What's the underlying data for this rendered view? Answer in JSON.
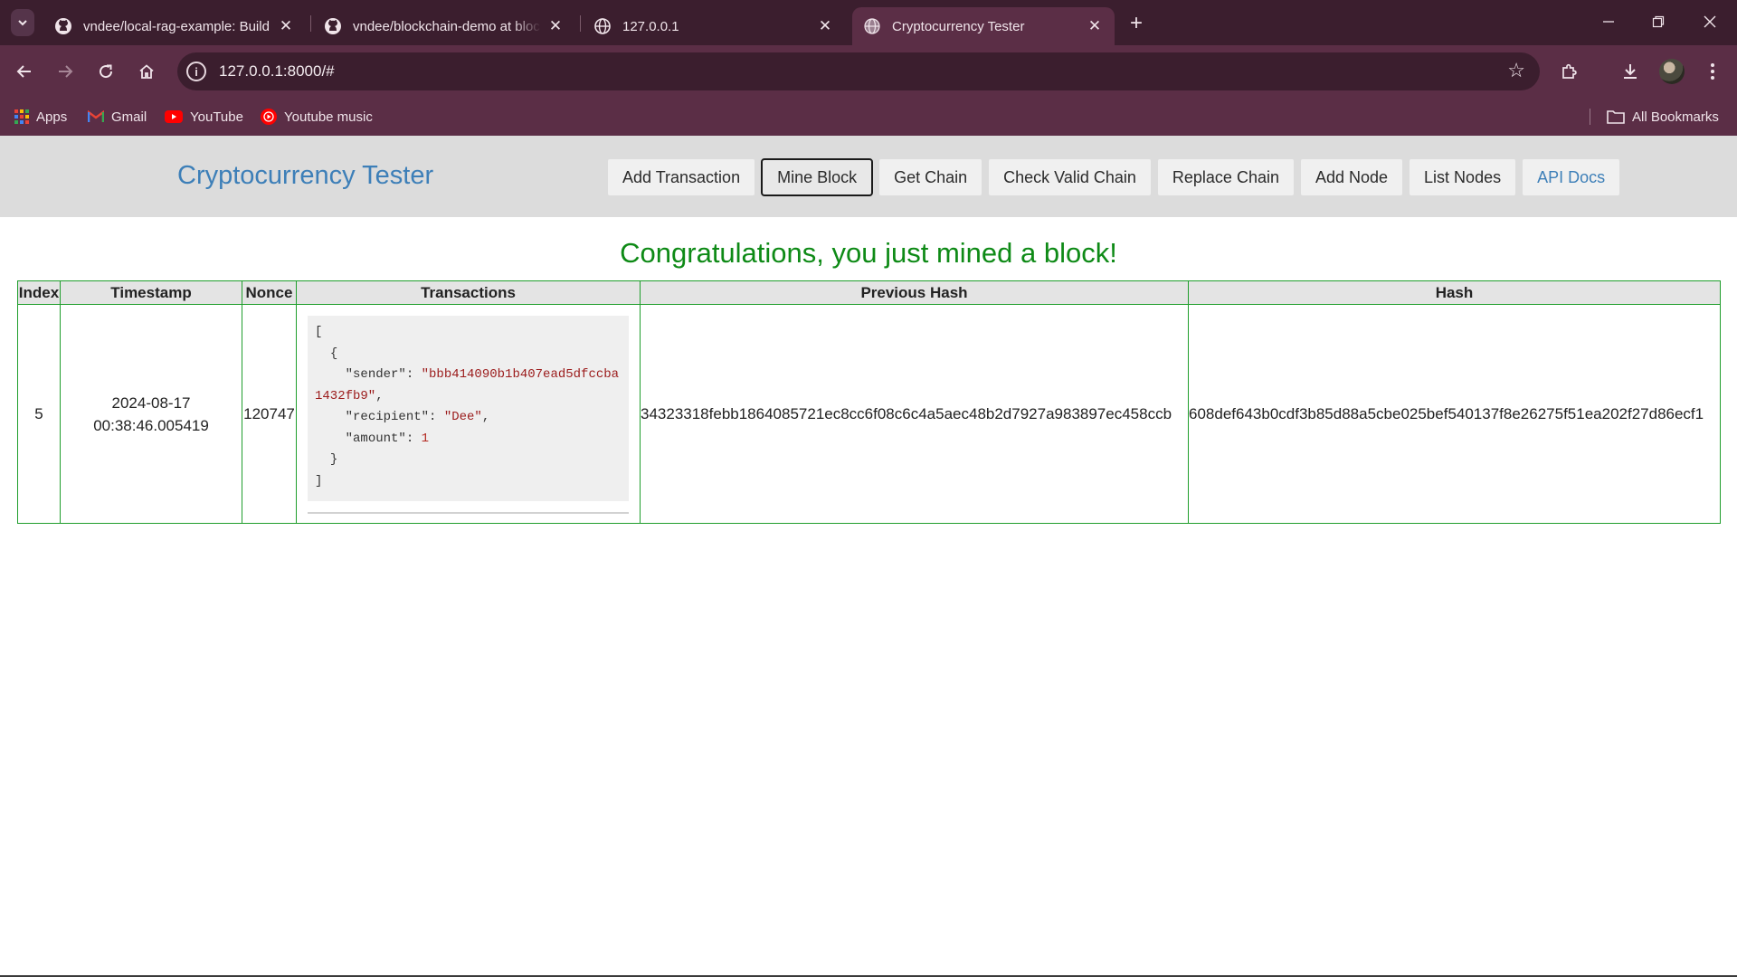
{
  "browser": {
    "tabs": [
      {
        "title": "vndee/local-rag-example: Build",
        "icon": "github-icon"
      },
      {
        "title": "vndee/blockchain-demo at blockchain",
        "icon": "github-icon"
      },
      {
        "title": "127.0.0.1",
        "icon": "globe-icon"
      },
      {
        "title": "Cryptocurrency Tester",
        "icon": "globe-icon",
        "active": true
      }
    ],
    "url": "127.0.0.1:8000/#",
    "bookmarks": [
      {
        "label": "Apps",
        "icon": "apps-grid-icon"
      },
      {
        "label": "Gmail",
        "icon": "gmail-icon"
      },
      {
        "label": "YouTube",
        "icon": "youtube-icon"
      },
      {
        "label": "Youtube music",
        "icon": "youtube-music-icon"
      }
    ],
    "all_bookmarks": "All Bookmarks"
  },
  "app": {
    "brand": "Cryptocurrency Tester",
    "nav": [
      "Add Transaction",
      "Mine Block",
      "Get Chain",
      "Check Valid Chain",
      "Replace Chain",
      "Add Node",
      "List Nodes",
      "API Docs"
    ],
    "headline": "Congratulations, you just mined a block!",
    "table": {
      "headers": [
        "Index",
        "Timestamp",
        "Nonce",
        "Transactions",
        "Previous Hash",
        "Hash"
      ],
      "row": {
        "index": "5",
        "timestamp_date": "2024-08-17",
        "timestamp_time": "00:38:46.005419",
        "nonce": "120747",
        "transaction": {
          "sender": "\"bbb414090b1b407ead5dfccba1432fb9\"",
          "recipient": "\"Dee\"",
          "amount": "1"
        },
        "previous_hash": "34323318febb1864085721ec8cc6f08c6c4a5aec48b2d7927a983897ec458ccb",
        "hash": "608def643b0cdf3b85d88a5cbe025bef540137f8e26275f51ea202f27d86ecf1"
      }
    }
  },
  "colors": {
    "chrome_dark": "#3b1e2e",
    "chrome": "#5b2e46",
    "brand": "#3d7fb8",
    "success": "#0e8a16",
    "table_border": "#1f9e2c"
  }
}
